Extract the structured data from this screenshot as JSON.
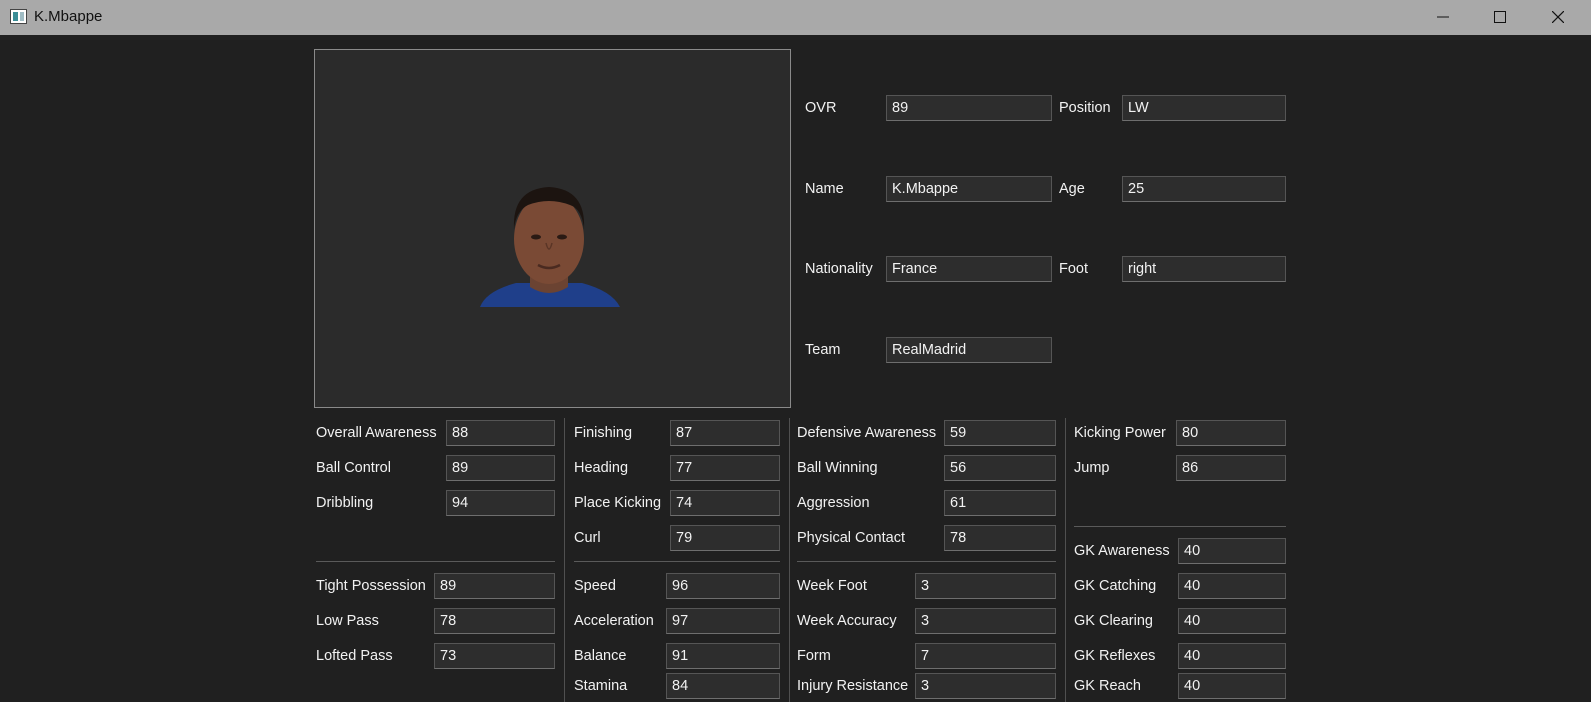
{
  "window": {
    "title": "K.Mbappe"
  },
  "profile": {
    "ovr_label": "OVR",
    "ovr": "89",
    "position_label": "Position",
    "position": "LW",
    "name_label": "Name",
    "name": "K.Mbappe",
    "age_label": "Age",
    "age": "25",
    "nationality_label": "Nationality",
    "nationality": "France",
    "foot_label": "Foot",
    "foot": "right",
    "team_label": "Team",
    "team": "RealMadrid"
  },
  "stats": {
    "overall_awareness": {
      "label": "Overall Awareness",
      "value": "88"
    },
    "ball_control": {
      "label": "Ball Control",
      "value": "89"
    },
    "dribbling": {
      "label": "Dribbling",
      "value": "94"
    },
    "tight_possession": {
      "label": "Tight Possession",
      "value": "89"
    },
    "low_pass": {
      "label": "Low Pass",
      "value": "78"
    },
    "lofted_pass": {
      "label": "Lofted Pass",
      "value": "73"
    },
    "finishing": {
      "label": "Finishing",
      "value": "87"
    },
    "heading": {
      "label": "Heading",
      "value": "77"
    },
    "place_kicking": {
      "label": "Place Kicking",
      "value": "74"
    },
    "curl": {
      "label": "Curl",
      "value": "79"
    },
    "speed": {
      "label": "Speed",
      "value": "96"
    },
    "acceleration": {
      "label": "Acceleration",
      "value": "97"
    },
    "balance": {
      "label": "Balance",
      "value": "91"
    },
    "stamina": {
      "label": "Stamina",
      "value": "84"
    },
    "defensive_awareness": {
      "label": "Defensive Awareness",
      "value": "59"
    },
    "ball_winning": {
      "label": "Ball Winning",
      "value": "56"
    },
    "aggression": {
      "label": "Aggression",
      "value": "61"
    },
    "physical_contact": {
      "label": "Physical Contact",
      "value": "78"
    },
    "week_foot": {
      "label": "Week Foot",
      "value": "3"
    },
    "week_accuracy": {
      "label": "Week Accuracy",
      "value": "3"
    },
    "form": {
      "label": "Form",
      "value": "7"
    },
    "injury_resistance": {
      "label": "Injury Resistance",
      "value": "3"
    },
    "kicking_power": {
      "label": "Kicking Power",
      "value": "80"
    },
    "jump": {
      "label": "Jump",
      "value": "86"
    },
    "gk_awareness": {
      "label": "GK Awareness",
      "value": "40"
    },
    "gk_catching": {
      "label": "GK Catching",
      "value": "40"
    },
    "gk_clearing": {
      "label": "GK Clearing",
      "value": "40"
    },
    "gk_reflexes": {
      "label": "GK Reflexes",
      "value": "40"
    },
    "gk_reach": {
      "label": "GK Reach",
      "value": "40"
    }
  }
}
